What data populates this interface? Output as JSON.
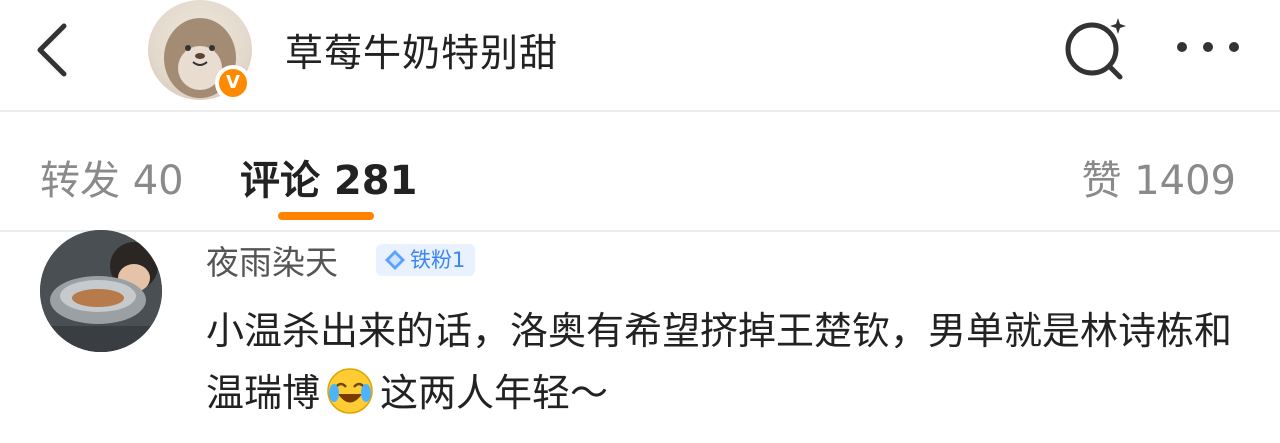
{
  "header": {
    "title": "草莓牛奶特别甜",
    "verified_badge": "V",
    "icons": [
      "back-arrow-icon",
      "avatar",
      "search-icon",
      "more-icon"
    ]
  },
  "tabs": [
    {
      "label": "转发 40"
    },
    {
      "label": "评论 281"
    },
    {
      "label": "赞 1409"
    }
  ],
  "colors": {
    "accent": "#ff8200",
    "badge_blue": "#3b86f0",
    "verified": "#ff8a00"
  },
  "comment": {
    "username": "夜雨染天",
    "badge": "铁粉1",
    "text_part1": "小温杀出来的话，洛奥有希望挤掉王楚钦，男单就是林诗栋和温瑞博",
    "emoji": "laughing-crying-emoji",
    "text_part2": "这两人年轻～"
  }
}
